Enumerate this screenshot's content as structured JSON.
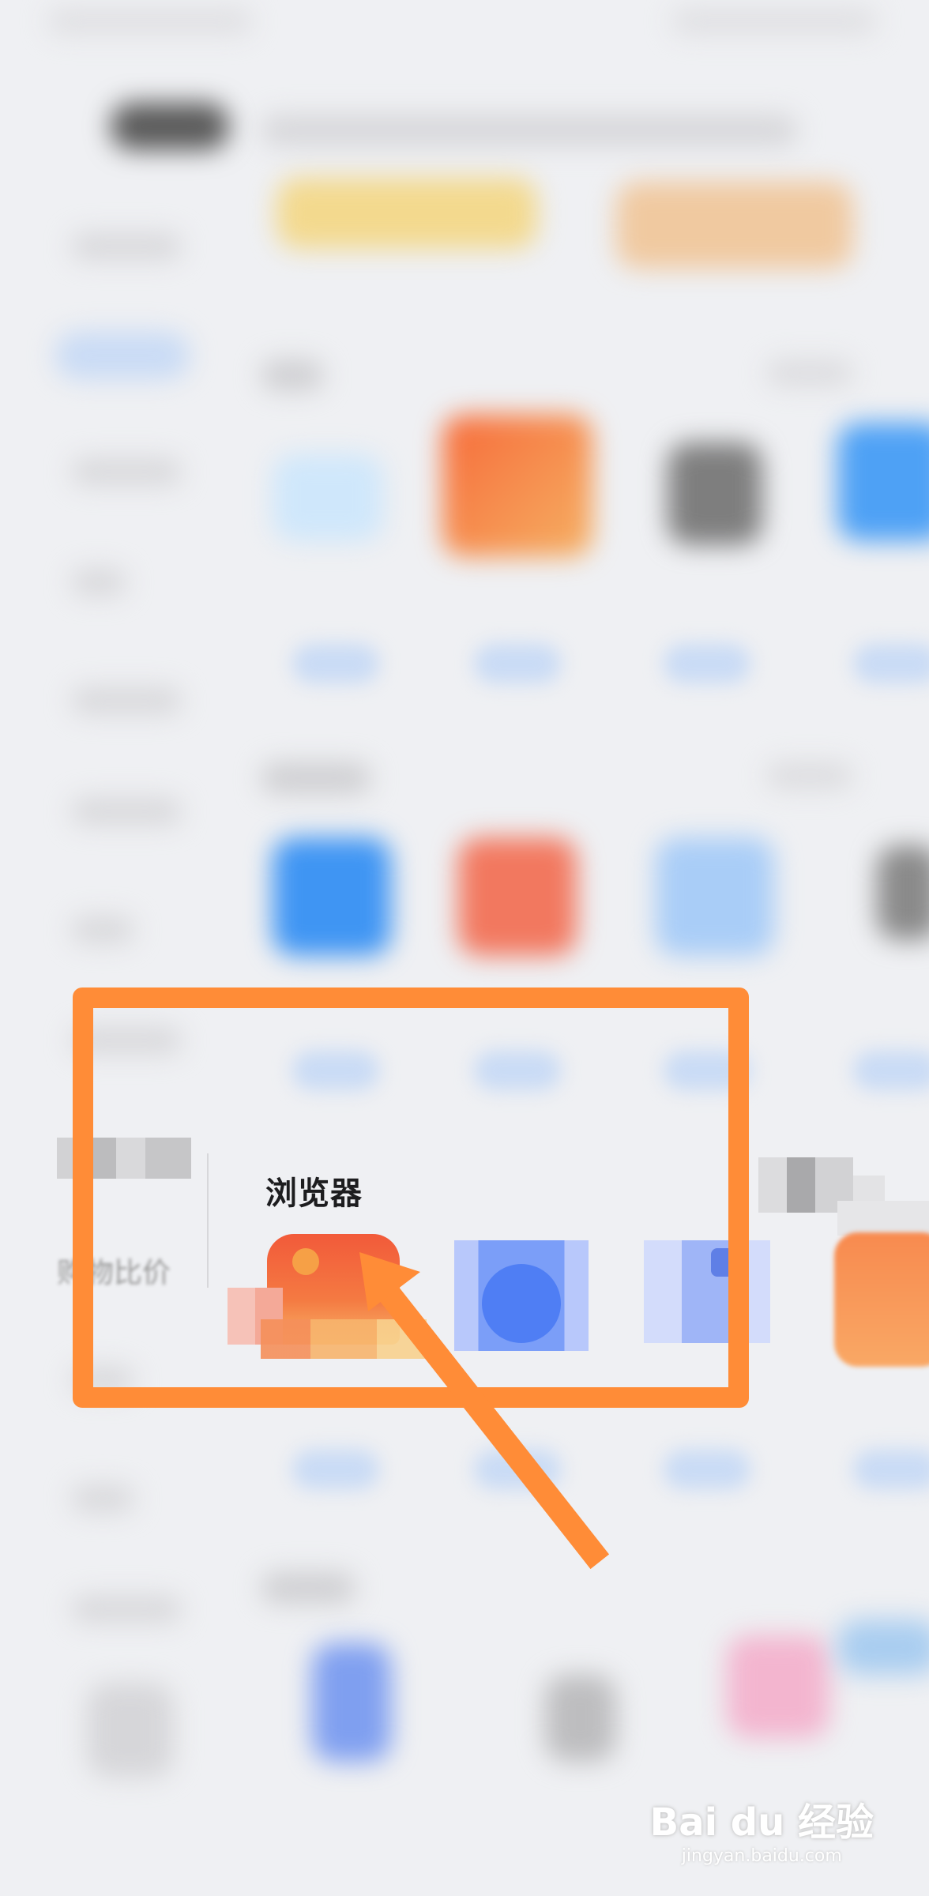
{
  "highlight": {
    "category_label": "浏览器",
    "sidebar_label": "购物比价"
  },
  "watermark": {
    "brand": "Bai du 经验",
    "url": "jingyan.baidu.com"
  },
  "colors": {
    "annotation": "#ff8c37",
    "background": "#eff0f3",
    "app_primary": "#f26a3a",
    "app_secondary": "#4f86f7"
  },
  "icons": [
    "browser-app-icon",
    "blue-app-icon",
    "blue-app-icon-2",
    "orange-app-icon",
    "arrow-annotation"
  ]
}
